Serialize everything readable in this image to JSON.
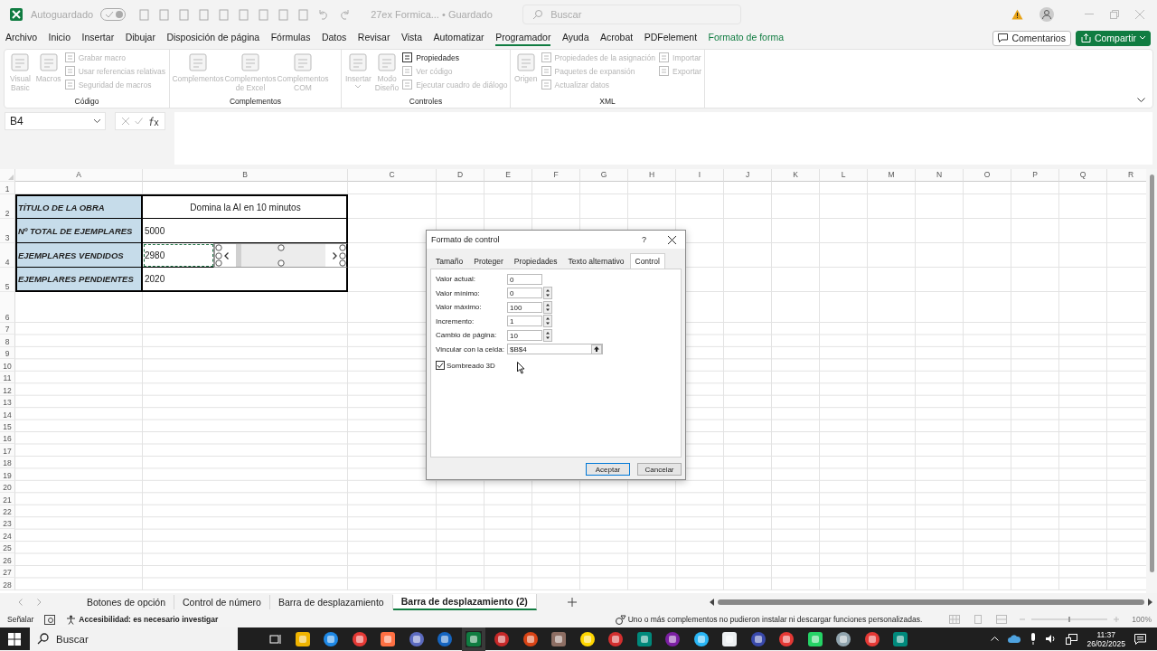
{
  "title_bar": {
    "autosave_label": "Autoguardado",
    "autosave_on": false,
    "document_title": "27ex Formica... • Guardado",
    "search_placeholder": "Buscar"
  },
  "menu": [
    {
      "label": "Archivo",
      "selected": false,
      "kind": "tab"
    },
    {
      "label": "Inicio",
      "selected": false,
      "kind": "tab"
    },
    {
      "label": "Insertar",
      "selected": false,
      "kind": "tab"
    },
    {
      "label": "Dibujar",
      "selected": false,
      "kind": "tab"
    },
    {
      "label": "Disposición de página",
      "selected": false,
      "kind": "tab"
    },
    {
      "label": "Fórmulas",
      "selected": false,
      "kind": "tab"
    },
    {
      "label": "Datos",
      "selected": false,
      "kind": "tab"
    },
    {
      "label": "Revisar",
      "selected": false,
      "kind": "tab"
    },
    {
      "label": "Vista",
      "selected": false,
      "kind": "tab"
    },
    {
      "label": "Automatizar",
      "selected": false,
      "kind": "tab"
    },
    {
      "label": "Programador",
      "selected": true,
      "kind": "tab"
    },
    {
      "label": "Ayuda",
      "selected": false,
      "kind": "tab"
    },
    {
      "label": "Acrobat",
      "selected": false,
      "kind": "tab"
    },
    {
      "label": "PDFelement",
      "selected": false,
      "kind": "tab"
    },
    {
      "label": "Formato de forma",
      "selected": false,
      "kind": "contextual"
    }
  ],
  "header_buttons": {
    "comments": "Comentarios",
    "share": "Compartir"
  },
  "ribbon": [
    {
      "label": "Código",
      "items": [
        {
          "kind": "large",
          "label": "Visual Basic",
          "disabled": true,
          "dropdown": false
        },
        {
          "kind": "large",
          "label": "Macros",
          "disabled": true,
          "dropdown": false
        },
        {
          "kind": "small",
          "label": "Grabar macro",
          "disabled": true
        },
        {
          "kind": "small",
          "label": "Usar referencias relativas",
          "disabled": true
        },
        {
          "kind": "small",
          "label": "Seguridad de macros",
          "disabled": true
        }
      ]
    },
    {
      "label": "Complementos",
      "items": [
        {
          "kind": "large",
          "label": "Complementos",
          "disabled": true,
          "dropdown": false
        },
        {
          "kind": "large",
          "label": "Complementos de Excel",
          "disabled": true,
          "dropdown": false
        },
        {
          "kind": "large",
          "label": "Complementos COM",
          "disabled": true,
          "dropdown": false
        }
      ]
    },
    {
      "label": "Controles",
      "items": [
        {
          "kind": "large",
          "label": "Insertar",
          "disabled": true,
          "dropdown": true
        },
        {
          "kind": "large",
          "label": "Modo Diseño",
          "disabled": true,
          "dropdown": false
        },
        {
          "kind": "small",
          "label": "Propiedades",
          "disabled": false
        },
        {
          "kind": "small",
          "label": "Ver código",
          "disabled": true
        },
        {
          "kind": "small",
          "label": "Ejecutar cuadro de diálogo",
          "disabled": true
        }
      ]
    },
    {
      "label": "XML",
      "items": [
        {
          "kind": "large",
          "label": "Origen",
          "disabled": true,
          "dropdown": false
        },
        {
          "kind": "small",
          "label": "Propiedades de la asignación",
          "disabled": true
        },
        {
          "kind": "small",
          "label": "Paquetes de expansión",
          "disabled": true
        },
        {
          "kind": "small",
          "label": "Actualizar datos",
          "disabled": true
        },
        {
          "kind": "small",
          "label": "Importar",
          "disabled": true
        },
        {
          "kind": "small",
          "label": "Exportar",
          "disabled": true
        }
      ]
    }
  ],
  "formula_bar": {
    "name_box": "B4"
  },
  "sheet": {
    "columns": [
      "A",
      "B",
      "C",
      "D",
      "E",
      "F",
      "G",
      "H",
      "I",
      "J",
      "K",
      "L",
      "M",
      "N",
      "O",
      "P",
      "Q",
      "R"
    ],
    "rows": [
      "1",
      "2",
      "3",
      "4",
      "5",
      "6",
      "7",
      "8",
      "9",
      "10",
      "11",
      "12",
      "13",
      "14",
      "15",
      "16",
      "17",
      "18",
      "19",
      "20",
      "21",
      "22",
      "23",
      "24",
      "25",
      "26",
      "27",
      "28"
    ],
    "table": [
      {
        "label": "TÍTULO DE LA OBRA",
        "value": "Domina la AI en 10 minutos",
        "kind": "title",
        "selected": false
      },
      {
        "label": "Nº TOTAL DE EJEMPLARES",
        "value": "5000",
        "kind": "number",
        "selected": false
      },
      {
        "label": "EJEMPLARES VENDIDOS",
        "value": "2980",
        "kind": "number",
        "selected": true
      },
      {
        "label": "EJEMPLARES PENDIENTES",
        "value": "2020",
        "kind": "number",
        "selected": false
      }
    ],
    "scrollbar_control": {
      "kind": "horizontal"
    }
  },
  "dialog": {
    "title": "Formato de control",
    "help": "?",
    "tabs": [
      {
        "label": "Tamaño",
        "selected": false
      },
      {
        "label": "Proteger",
        "selected": false
      },
      {
        "label": "Propiedades",
        "selected": false
      },
      {
        "label": "Texto alternativo",
        "selected": false
      },
      {
        "label": "Control",
        "selected": true
      }
    ],
    "fields": [
      {
        "label": "Valor actual:",
        "value": "0",
        "kind": "text"
      },
      {
        "label": "Valor mínimo:",
        "value": "0",
        "kind": "spin"
      },
      {
        "label": "Valor máximo:",
        "value": "100",
        "kind": "spin"
      },
      {
        "label": "Incremento:",
        "value": "1",
        "kind": "spin"
      },
      {
        "label": "Cambio de página:",
        "value": "10",
        "kind": "spin"
      },
      {
        "label": "Vincular con la celda:",
        "value": "$B$4",
        "kind": "ref"
      }
    ],
    "checkbox": {
      "label": "Sombreado 3D",
      "checked": true
    },
    "buttons": [
      {
        "label": "Aceptar",
        "default": true
      },
      {
        "label": "Cancelar",
        "default": false
      }
    ]
  },
  "sheet_tabs": [
    {
      "label": "Botones de opción",
      "selected": false
    },
    {
      "label": "Control de número",
      "selected": false
    },
    {
      "label": "Barra de desplazamiento",
      "selected": false
    },
    {
      "label": "Barra de desplazamiento (2)",
      "selected": true
    }
  ],
  "status_bar": {
    "mode": "Señalar",
    "accessibility": "Accesibilidad: es necesario investigar",
    "message": "Uno o más complementos no pudieron instalar ni descargar funciones personalizadas.",
    "zoom": "100%",
    "zoom_slider": {
      "level": 0.5
    }
  },
  "taskbar": {
    "search_placeholder": "Buscar",
    "time": "11:37",
    "date": "26/02/2025"
  }
}
